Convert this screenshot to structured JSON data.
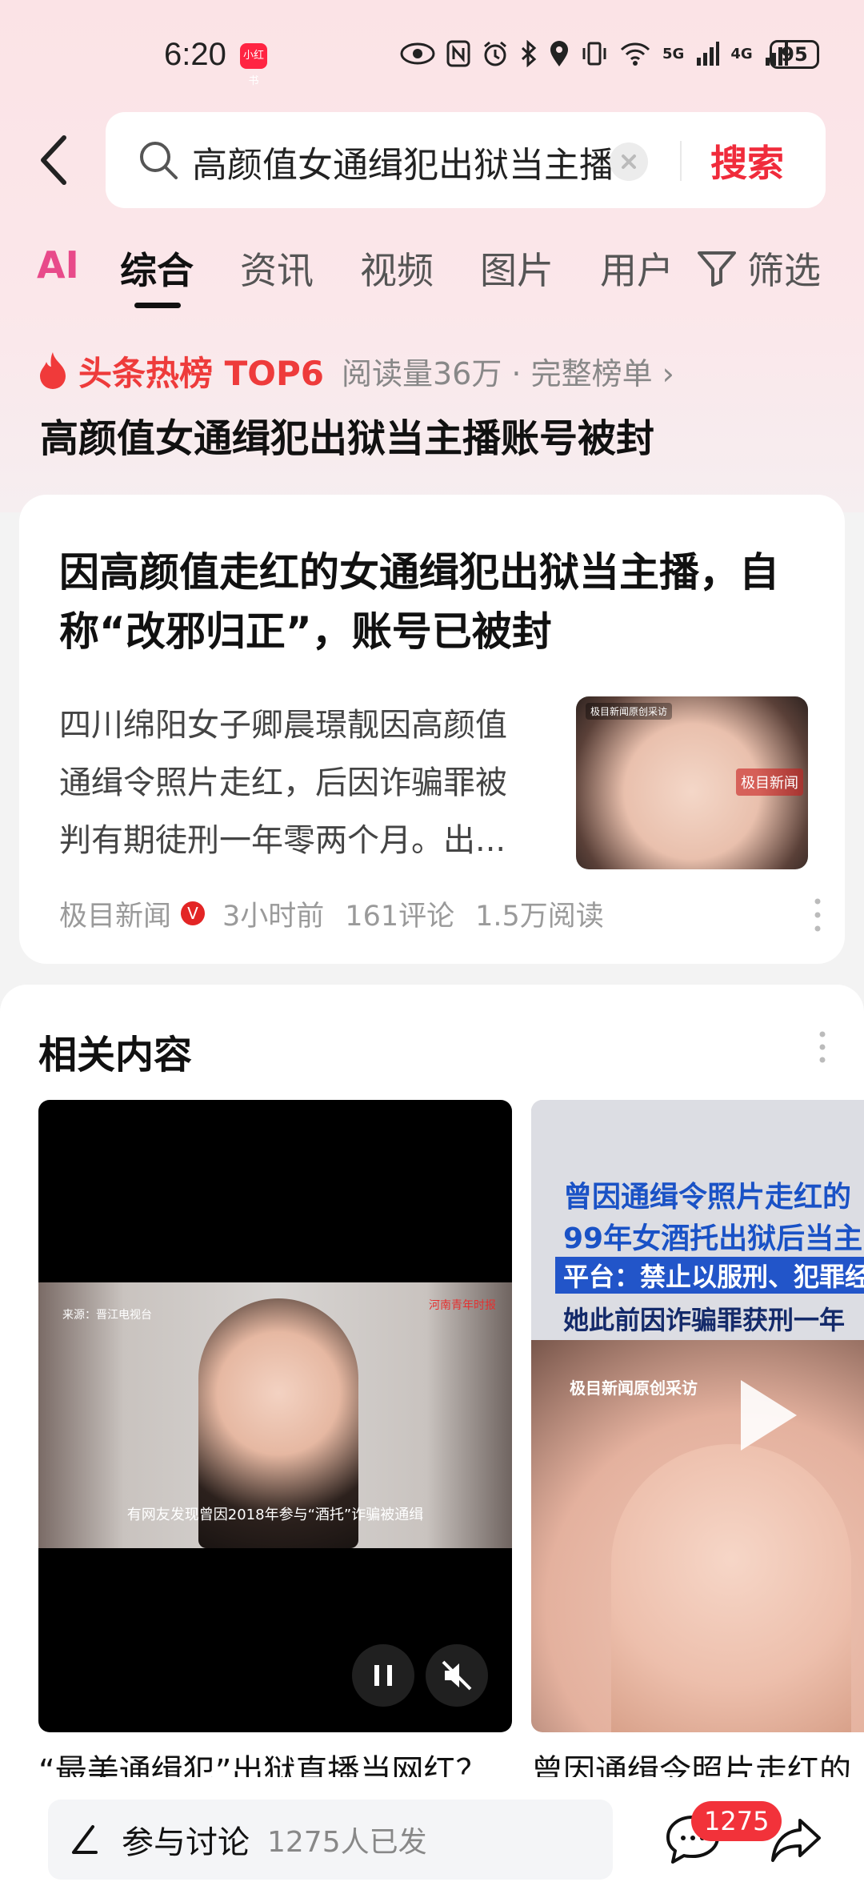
{
  "status_bar": {
    "time": "6:20",
    "app_badge": "小红书",
    "network_1": "5G",
    "network_2": "4G",
    "battery": "95"
  },
  "search": {
    "query": "高颜值女通缉犯出狱当主播",
    "button": "搜索"
  },
  "tabs": {
    "ai": "AI",
    "items": [
      "综合",
      "资讯",
      "视频",
      "图片",
      "用户"
    ],
    "filter": "筛选"
  },
  "hot": {
    "label": "头条热榜 TOP6",
    "meta": "阅读量36万 · 完整榜单 ›",
    "title": "高颜值女通缉犯出狱当主播账号被封"
  },
  "article": {
    "title": "因高颜值走红的女通缉犯出狱当主播，自称“改邪归正”，账号已被封",
    "summary": "四川绵阳女子卿晨璟靓因高颜值通缉令照片走红，后因诈骗罪被判有期徒刑一年零两个月。出...",
    "thumb_tag": "极目新闻原创采访",
    "thumb_logo": "极目新闻",
    "source": "极目新闻",
    "verified": "V",
    "time": "3小时前",
    "comments": "161评论",
    "reads": "1.5万阅读"
  },
  "related": {
    "title": "相关内容",
    "video1": {
      "source": "来源：晋江电视台",
      "brand": "河南青年时报",
      "subtitle": "有网友发现曾因2018年参与“酒托”诈骗被通缉",
      "caption": "“最美通缉犯”出狱直播当网红？"
    },
    "video2": {
      "line1": "曾因通缉令照片走红的",
      "line2": "99年女酒托出狱后当主",
      "line3": "平台：禁止以服刑、犯罪经",
      "line4": "她此前因诈骗罪获刑一年",
      "credit": "极目新闻原创采访",
      "caption": "曾因通缉令照片走红的"
    }
  },
  "bottom": {
    "discuss": "参与讨论",
    "discuss_count": "1275人已发",
    "comment_badge": "1275"
  }
}
